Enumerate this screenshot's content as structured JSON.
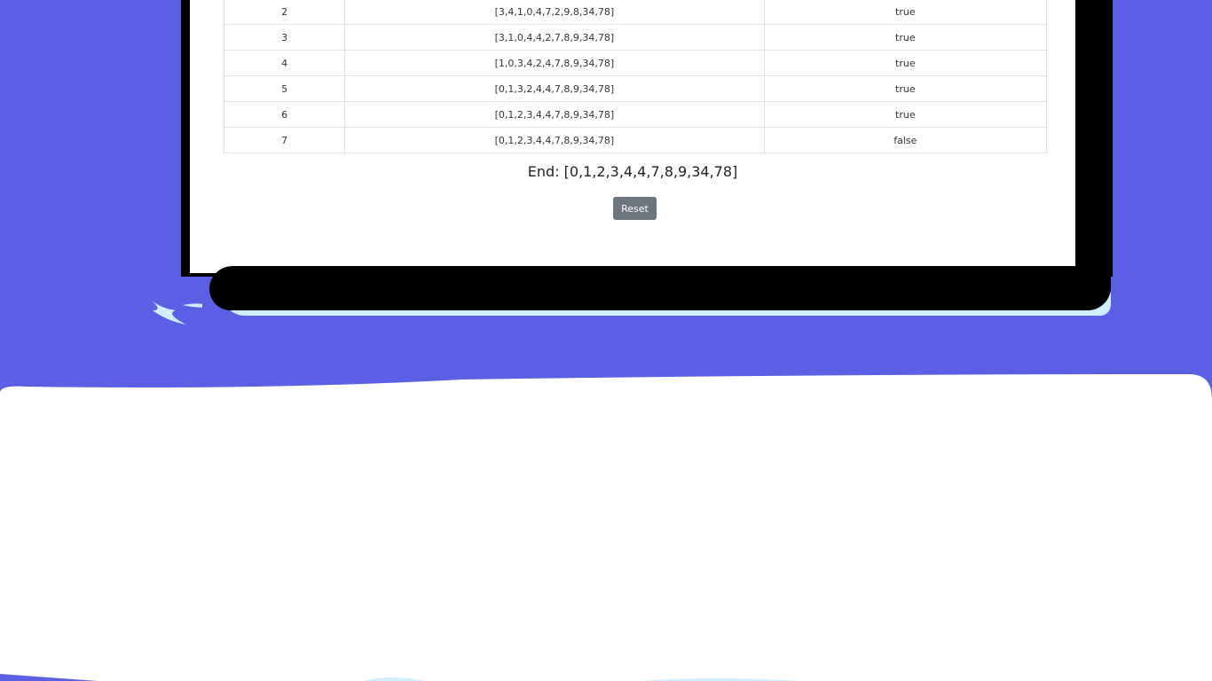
{
  "table": {
    "rows": [
      {
        "step": "2",
        "array": "[3,4,1,0,4,7,2,9,8,34,78]",
        "swapped": "true"
      },
      {
        "step": "3",
        "array": "[3,1,0,4,4,2,7,8,9,34,78]",
        "swapped": "true"
      },
      {
        "step": "4",
        "array": "[1,0,3,4,2,4,7,8,9,34,78]",
        "swapped": "true"
      },
      {
        "step": "5",
        "array": "[0,1,3,2,4,4,7,8,9,34,78]",
        "swapped": "true"
      },
      {
        "step": "6",
        "array": "[0,1,2,3,4,4,7,8,9,34,78]",
        "swapped": "true"
      },
      {
        "step": "7",
        "array": "[0,1,2,3,4,4,7,8,9,34,78]",
        "swapped": "false"
      }
    ]
  },
  "result": {
    "end_text": "End: [0,1,2,3,4,4,7,8,9,34,78]"
  },
  "controls": {
    "reset_label": "Reset"
  },
  "colors": {
    "background": "#5b5fe3",
    "frame": "#000000",
    "button": "#6c757d",
    "accent_light": "#cfeeff"
  }
}
